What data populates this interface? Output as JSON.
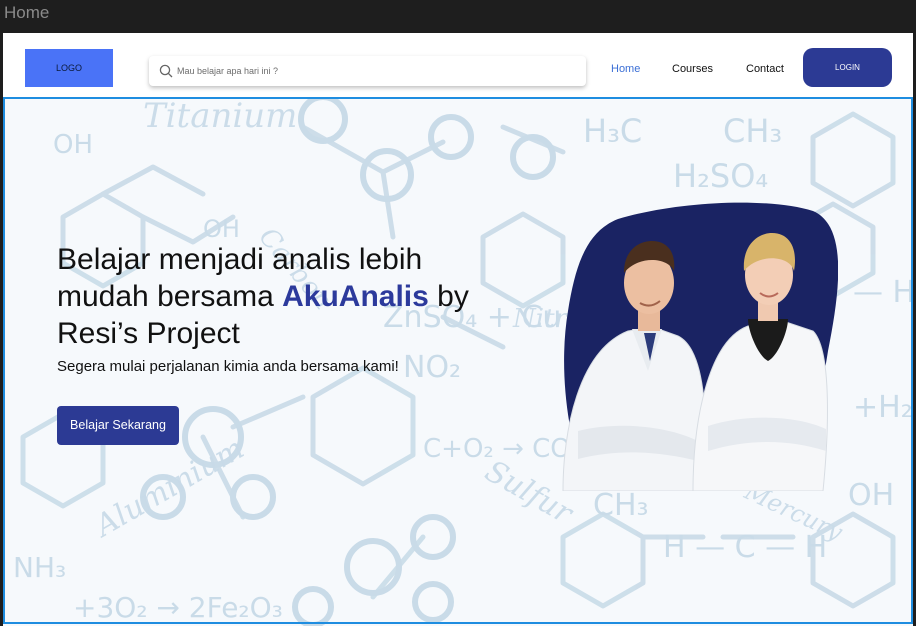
{
  "frame": {
    "title": "Home"
  },
  "navbar": {
    "logo_text": "LOGO",
    "search": {
      "placeholder": "Mau belajar apa hari ini ?",
      "value": ""
    },
    "links": {
      "home": "Home",
      "courses": "Courses",
      "contact": "Contact"
    },
    "login_label": "LOGIN"
  },
  "hero": {
    "headline_part1": "Belajar menjadi analis lebih mudah bersama ",
    "headline_brand": "AkuAnalis",
    "headline_part2": " by Resi’s Project",
    "subtitle": "Segera mulai perjalanan kimia anda bersama kami!",
    "cta_label": "Belajar Sekarang"
  },
  "colors": {
    "primary": "#2c3a94",
    "logo_bg": "#4a73f7",
    "nav_active": "#3b6fd6",
    "blob": "#1a2363",
    "hero_bg": "#f6f9fc",
    "doodle": "#c9dbe8"
  }
}
